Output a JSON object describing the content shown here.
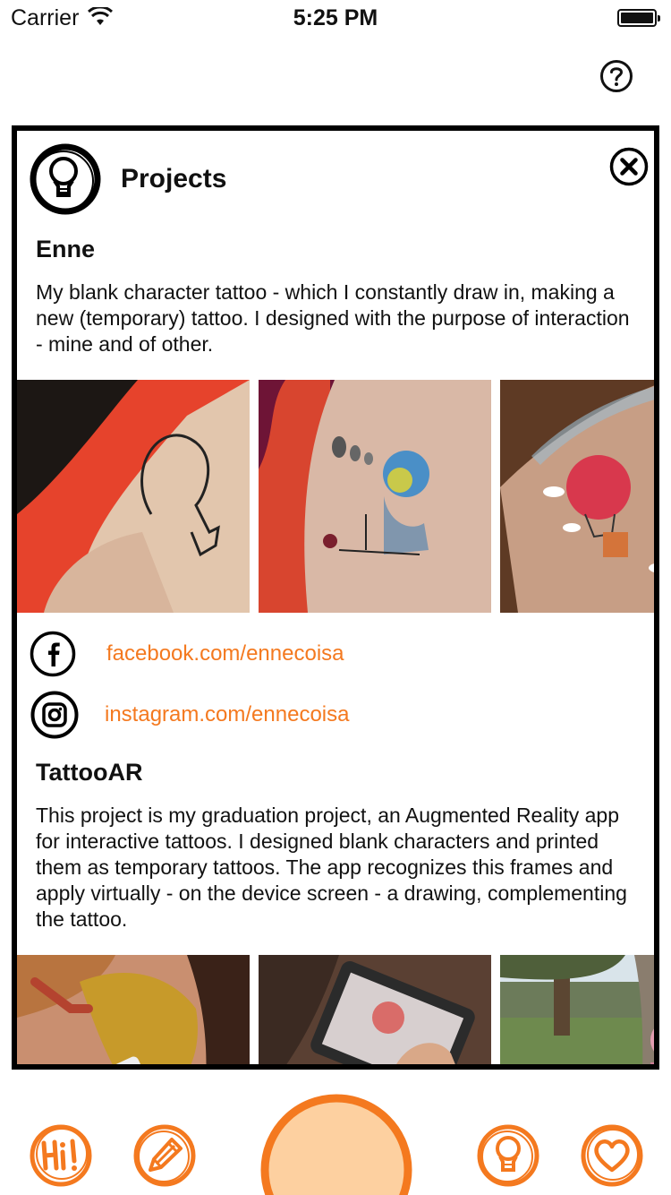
{
  "status_bar": {
    "carrier": "Carrier",
    "time": "5:25 PM"
  },
  "panel": {
    "title": "Projects",
    "projects": [
      {
        "name": "Enne",
        "description": "My blank character tattoo - which I constantly draw in, making a new (temporary) tattoo. I designed with the purpose of interaction - mine and of other.",
        "links": [
          {
            "icon": "facebook-icon",
            "text": "facebook.com/ennecoisa"
          },
          {
            "icon": "instagram-icon",
            "text": "instagram.com/ennecoisa"
          }
        ]
      },
      {
        "name": "TattooAR",
        "description": "This project is my graduation project, an Augmented Reality app for interactive tattoos. I designed blank characters and printed them as temporary tattoos. The app recognizes this frames and apply virtually - on the device screen - a drawing, complementing the tattoo."
      }
    ]
  },
  "tabbar": {
    "tabs": [
      "hi-icon",
      "pencil-icon",
      "capture-icon",
      "lightbulb-icon",
      "heart-icon"
    ]
  },
  "colors": {
    "accent": "#f4791f",
    "capture_fill": "#fdd0a0",
    "border": "#000000"
  }
}
